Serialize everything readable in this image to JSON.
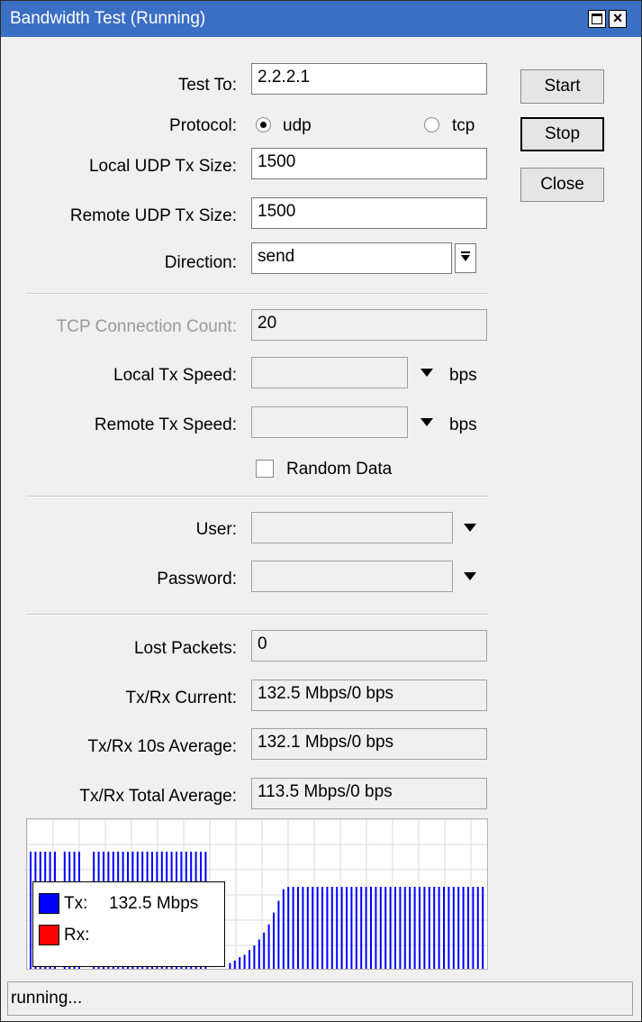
{
  "window": {
    "title": "Bandwidth Test (Running)"
  },
  "buttons": {
    "start": "Start",
    "stop": "Stop",
    "close": "Close"
  },
  "form": {
    "test_to": {
      "label": "Test To:",
      "value": "2.2.2.1"
    },
    "protocol": {
      "label": "Protocol:",
      "options": [
        "udp",
        "tcp"
      ],
      "selected": "udp"
    },
    "local_udp_tx_size": {
      "label": "Local UDP Tx Size:",
      "value": "1500"
    },
    "remote_udp_tx_size": {
      "label": "Remote UDP Tx Size:",
      "value": "1500"
    },
    "direction": {
      "label": "Direction:",
      "value": "send"
    },
    "tcp_connection_count": {
      "label": "TCP Connection Count:",
      "value": "20"
    },
    "local_tx_speed": {
      "label": "Local Tx Speed:",
      "value": "",
      "unit": "bps"
    },
    "remote_tx_speed": {
      "label": "Remote Tx Speed:",
      "value": "",
      "unit": "bps"
    },
    "random_data": {
      "label": "Random Data",
      "checked": false
    },
    "user": {
      "label": "User:",
      "value": ""
    },
    "password": {
      "label": "Password:",
      "value": ""
    }
  },
  "stats": {
    "lost_packets": {
      "label": "Lost Packets:",
      "value": "0"
    },
    "current": {
      "label": "Tx/Rx Current:",
      "value": "132.5 Mbps/0 bps"
    },
    "avg10s": {
      "label": "Tx/Rx 10s Average:",
      "value": "132.1 Mbps/0 bps"
    },
    "total_avg": {
      "label": "Tx/Rx Total Average:",
      "value": "113.5 Mbps/0 bps"
    }
  },
  "graph": {
    "tx_color": "#0000ff",
    "rx_color": "#ff0000",
    "legend": {
      "tx": "Tx:",
      "tx_value": "132.5 Mbps",
      "rx": "Rx:"
    },
    "tx_levels": [
      1,
      1,
      1,
      1,
      1,
      1,
      0,
      1,
      1,
      1,
      1,
      0,
      0,
      1,
      1,
      1,
      1,
      1,
      1,
      1,
      1,
      1,
      1,
      1,
      1,
      1,
      1,
      1,
      1,
      1,
      1,
      1,
      1,
      1,
      1,
      1,
      1,
      0,
      0,
      0,
      0,
      0.05,
      0.07,
      0.1,
      0.12,
      0.16,
      0.2,
      0.25,
      0.31,
      0.38,
      0.48,
      0.58,
      0.68,
      0.7,
      0.7,
      0.7,
      0.7,
      0.7,
      0.7,
      0.7,
      0.7,
      0.7,
      0.7,
      0.7,
      0.7,
      0.7,
      0.7,
      0.7,
      0.7,
      0.7,
      0.7,
      0.7,
      0.7,
      0.7,
      0.7,
      0.7,
      0.7,
      0.7,
      0.7,
      0.7,
      0.7,
      0.7,
      0.7,
      0.7,
      0.7,
      0.7,
      0.7,
      0.7,
      0.7,
      0.7,
      0.7,
      0.7,
      0.7,
      0.7
    ]
  },
  "status": {
    "text": "running..."
  }
}
